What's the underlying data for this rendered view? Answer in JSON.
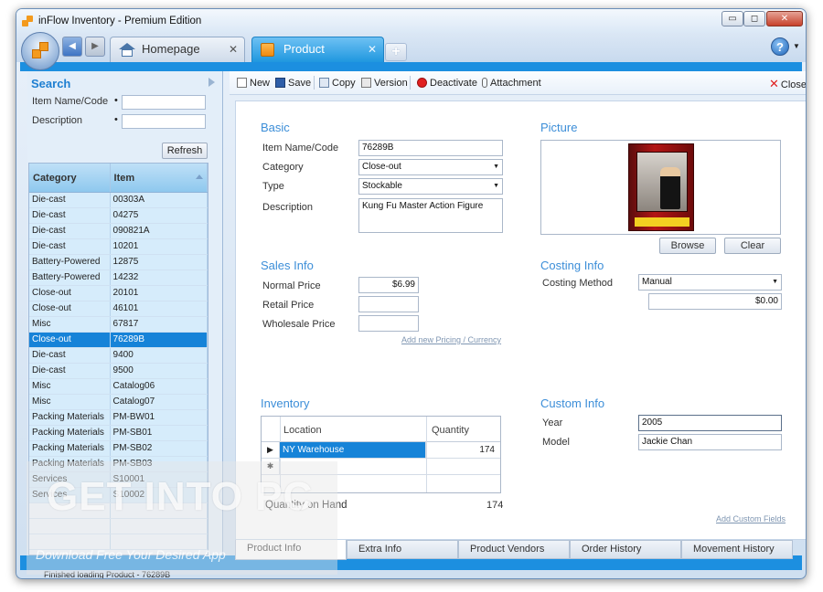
{
  "window": {
    "title": "inFlow Inventory - Premium Edition",
    "min": "▭",
    "max": "◻",
    "close": "✕"
  },
  "tabs": {
    "home": "Homepage",
    "product": "Product",
    "close": "✕",
    "new": "+",
    "back": "◀",
    "fwd": "▶",
    "help": "?",
    "help_caret": "▼"
  },
  "search": {
    "title": "Search",
    "fields": [
      {
        "label": "Item Name/Code"
      },
      {
        "label": "Description"
      }
    ],
    "dot": "•",
    "refresh": "Refresh",
    "columns": [
      "Category",
      "Item"
    ],
    "rows": [
      [
        "Die-cast",
        "00303A"
      ],
      [
        "Die-cast",
        "04275"
      ],
      [
        "Die-cast",
        "090821A"
      ],
      [
        "Die-cast",
        "10201"
      ],
      [
        "Battery-Powered",
        "12875"
      ],
      [
        "Battery-Powered",
        "14232"
      ],
      [
        "Close-out",
        "20101"
      ],
      [
        "Close-out",
        "46101"
      ],
      [
        "Misc",
        "67817"
      ],
      [
        "Close-out",
        "76289B"
      ],
      [
        "Die-cast",
        "9400"
      ],
      [
        "Die-cast",
        "9500"
      ],
      [
        "Misc",
        "Catalog06"
      ],
      [
        "Misc",
        "Catalog07"
      ],
      [
        "Packing Materials",
        "PM-BW01"
      ],
      [
        "Packing Materials",
        "PM-SB01"
      ],
      [
        "Packing Materials",
        "PM-SB02"
      ],
      [
        "Packing Materials",
        "PM-SB03"
      ],
      [
        "Services",
        "S10001"
      ],
      [
        "Services",
        "S10002"
      ]
    ],
    "selected_index": 9
  },
  "status": "Finished loading Product - 76289B",
  "toolbar": {
    "new": "New",
    "save": "Save",
    "copy": "Copy",
    "version": "Version",
    "deactivate": "Deactivate",
    "attachment": "Attachment",
    "close": "Close",
    "close_icon": "✕"
  },
  "basic": {
    "title": "Basic",
    "item_label": "Item Name/Code",
    "item_value": "76289B",
    "category_label": "Category",
    "category_value": "Close-out",
    "type_label": "Type",
    "type_value": "Stockable",
    "desc_label": "Description",
    "desc_value": "Kung Fu Master Action Figure"
  },
  "picture": {
    "title": "Picture",
    "browse": "Browse",
    "clear": "Clear"
  },
  "sales": {
    "title": "Sales Info",
    "normal_label": "Normal Price",
    "normal_value": "$6.99",
    "retail_label": "Retail Price",
    "retail_value": "",
    "wholesale_label": "Wholesale Price",
    "wholesale_value": "",
    "add_link": "Add new Pricing / Currency"
  },
  "costing": {
    "title": "Costing Info",
    "method_label": "Costing Method",
    "method_value": "Manual",
    "cost_value": "$0.00"
  },
  "inventory": {
    "title": "Inventory",
    "columns": [
      "Location",
      "Quantity"
    ],
    "rows": [
      {
        "location": "NY Warehouse",
        "quantity": "174"
      }
    ],
    "current_marker": "▶",
    "new_marker": "✱",
    "qoh_label": "Quantity on Hand",
    "qoh_value": "174"
  },
  "custom": {
    "title": "Custom Info",
    "year_label": "Year",
    "year_value": "2005",
    "model_label": "Model",
    "model_value": "Jackie Chan",
    "add_link": "Add Custom Fields"
  },
  "subtabs": [
    "Product Info",
    "Extra Info",
    "Product Vendors",
    "Order History",
    "Movement History"
  ],
  "dropdown_arrow": "▼",
  "watermark": {
    "big": "GET INTO PC",
    "small": "Download Free Your Desired App"
  },
  "colors": {
    "accent": "#1c8fe0",
    "selection": "#1683d8",
    "section_title": "#3c8ed8",
    "deactivate": "#e02020"
  }
}
